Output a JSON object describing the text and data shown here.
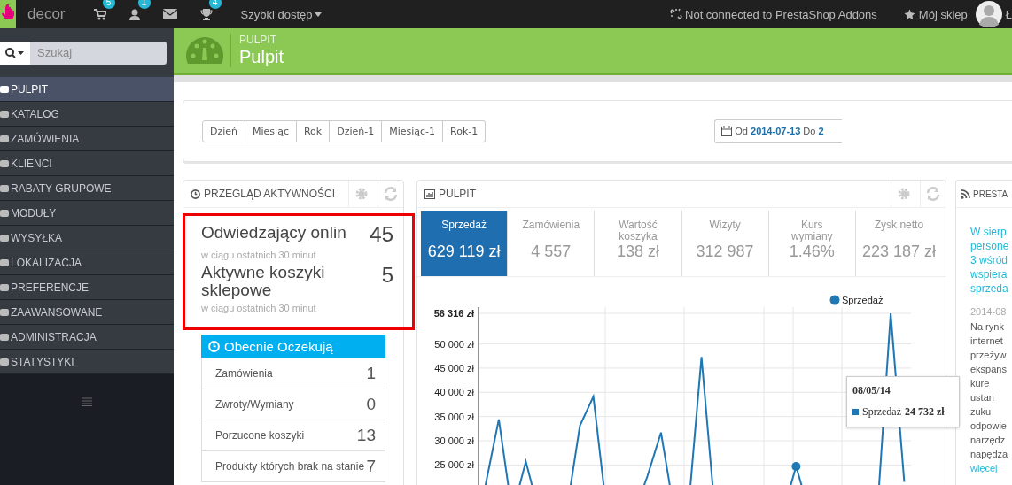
{
  "top_bar": {
    "shop_name": "decor",
    "icons": [
      {
        "kind": "cart",
        "badge": "5"
      },
      {
        "kind": "user",
        "badge": "1"
      },
      {
        "kind": "mail"
      },
      {
        "kind": "trophy",
        "badge": "4"
      }
    ],
    "quick_access": "Szybki dostęp",
    "addons_status": "Not connected to PrestaShop Addons",
    "my_shop": "Mój sklep",
    "user_name": "Ł"
  },
  "sidebar": {
    "search_placeholder": "Szukaj",
    "items": [
      {
        "label": "PULPIT",
        "selected": true
      },
      {
        "label": "KATALOG",
        "selected": false
      },
      {
        "label": "ZAMÓWIENIA",
        "selected": false
      },
      {
        "label": "KLIENCI",
        "selected": false
      },
      {
        "label": "RABATY GRUPOWE",
        "selected": false
      },
      {
        "label": "MODUŁY",
        "selected": false
      },
      {
        "label": "WYSYŁKA",
        "selected": false
      },
      {
        "label": "LOKALIZACJA",
        "selected": false
      },
      {
        "label": "PREFERENCJE",
        "selected": false
      },
      {
        "label": "ZAAWANSOWANE",
        "selected": false
      },
      {
        "label": "ADMINISTRACJA",
        "selected": false
      },
      {
        "label": "STATYSTYKI",
        "selected": false
      }
    ]
  },
  "page_header": {
    "breadcrumb": "PULPIT",
    "title": "Pulpit"
  },
  "date_filter": {
    "buttons": [
      "Dzień",
      "Miesiąc",
      "Rok",
      "Dzień-1",
      "Miesiąc-1",
      "Rok-1"
    ],
    "range": "Od **2014-07-13** Do **2**"
  },
  "activity": {
    "title": "PRZEGLĄD AKTYWNOŚCI",
    "stats": [
      {
        "label": "Odwiedzający onlin",
        "value": "45",
        "note": "w ciągu ostatnich 30 minut"
      },
      {
        "label": "Aktywne koszyki sklepowe",
        "value": "5",
        "note": "w ciągu ostatnich 30 minut"
      }
    ],
    "pending": {
      "title": "Obecnie Oczekują",
      "rows": [
        {
          "label": "Zamówienia",
          "value": "1"
        },
        {
          "label": "Zwroty/Wymiany",
          "value": "0"
        },
        {
          "label": "Porzucone koszyki",
          "value": "13"
        },
        {
          "label": "Produkty których brak na stanie",
          "value": "7"
        }
      ]
    }
  },
  "dashboard": {
    "title": "PULPIT",
    "kpis": [
      {
        "label": "Sprzedaż",
        "value": "629 119 zł",
        "selected": true
      },
      {
        "label": "Zamówienia",
        "value": "4 557",
        "selected": false
      },
      {
        "label": "Wartość koszyka",
        "value": "138 zł",
        "selected": false
      },
      {
        "label": "Wizyty",
        "value": "312 987",
        "selected": false
      },
      {
        "label": "Kurs wymiany",
        "value": "1.46%",
        "selected": false
      },
      {
        "label": "Zysk netto",
        "value": "223 187 zł",
        "selected": false
      }
    ],
    "chart_data": {
      "type": "line",
      "grid": true,
      "ylim": [
        20500,
        56316
      ],
      "yticks": [
        {
          "value": 56316,
          "label": "56 316 zł"
        },
        {
          "value": 50000,
          "label": "50 000 zł"
        },
        {
          "value": 45000,
          "label": "45 000 zł"
        },
        {
          "value": 40000,
          "label": "40 000 zł"
        },
        {
          "value": 35000,
          "label": "35 000 zł"
        },
        {
          "value": 30000,
          "label": "30 000 zł"
        },
        {
          "value": 25000,
          "label": "25 000 zł"
        }
      ],
      "series": [
        {
          "name": "Sprzedaż",
          "color": "#1f77b4",
          "values": [
            20600,
            34400,
            null,
            25700,
            null,
            null,
            null,
            33100,
            39100,
            null,
            null,
            null,
            22700,
            31700,
            null,
            null,
            47300,
            null,
            null,
            null,
            null,
            null,
            null,
            24700,
            null,
            null,
            null,
            null,
            null,
            null,
            56300,
            21500
          ]
        }
      ]
    },
    "tooltip": {
      "date": "08/05/14",
      "series": "Sprzedaż",
      "value": "24 732 zł"
    }
  },
  "news": {
    "title": "PRESTA",
    "headline_lines": [
      "W sierp",
      "persone",
      "3 wśród",
      "wspiera",
      "sprzeda"
    ],
    "date": "2014-08",
    "body_lines": [
      "Na rynk",
      "internet",
      "przeżyw",
      "ekspans",
      "kure",
      "ustan",
      "zuku",
      "odpowie",
      "narzędz",
      "napędza"
    ],
    "more": "więcej"
  }
}
